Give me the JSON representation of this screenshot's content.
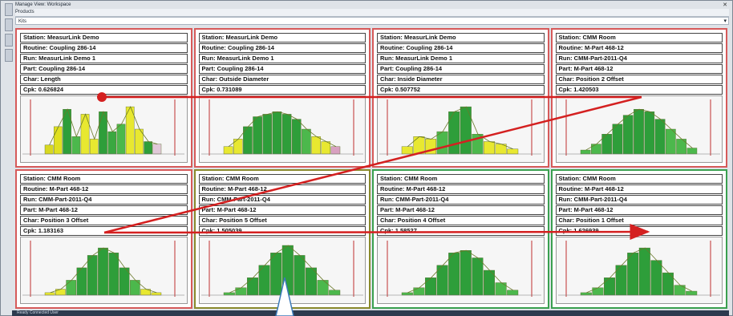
{
  "window": {
    "title": "Manage View: Workspace",
    "subtitle": "Products",
    "filter": "Kits"
  },
  "panels": [
    {
      "station": "Station: MeasurLink Demo",
      "routine": "Routine: Coupling 286-14",
      "run": "Run: MeasurLink Demo 1",
      "part": "Part: Coupling 286-14",
      "char": "Char: Length",
      "cpk": "Cpk: 0.626824",
      "status": "red",
      "bars": [
        {
          "v": 0.18,
          "c": "#d8d820"
        },
        {
          "v": 0.55,
          "c": "#e0e020"
        },
        {
          "v": 0.9,
          "c": "#2e9e3a"
        },
        {
          "v": 0.35,
          "c": "#4cb84c"
        },
        {
          "v": 0.8,
          "c": "#e8e830"
        },
        {
          "v": 0.3,
          "c": "#e8e830"
        },
        {
          "v": 0.85,
          "c": "#2e9e3a"
        },
        {
          "v": 0.45,
          "c": "#3aa840"
        },
        {
          "v": 0.6,
          "c": "#4cb84c"
        },
        {
          "v": 0.95,
          "c": "#e8e830"
        },
        {
          "v": 0.5,
          "c": "#e8e830"
        },
        {
          "v": 0.25,
          "c": "#2e9e3a"
        },
        {
          "v": 0.2,
          "c": "#e0c8d8"
        }
      ]
    },
    {
      "station": "Station: MeasurLink Demo",
      "routine": "Routine: Coupling 286-14",
      "run": "Run: MeasurLink Demo 1",
      "part": "Part: Coupling 286-14",
      "char": "Char: Outside Diameter",
      "cpk": "Cpk: 0.731089",
      "status": "red",
      "bars": [
        {
          "v": 0.15,
          "c": "#e8e830"
        },
        {
          "v": 0.3,
          "c": "#e8e830"
        },
        {
          "v": 0.55,
          "c": "#2e9e3a"
        },
        {
          "v": 0.75,
          "c": "#2e9e3a"
        },
        {
          "v": 0.8,
          "c": "#2e9e3a"
        },
        {
          "v": 0.85,
          "c": "#2e9e3a"
        },
        {
          "v": 0.8,
          "c": "#2e9e3a"
        },
        {
          "v": 0.7,
          "c": "#2e9e3a"
        },
        {
          "v": 0.5,
          "c": "#4cb84c"
        },
        {
          "v": 0.35,
          "c": "#e8e830"
        },
        {
          "v": 0.25,
          "c": "#e8e830"
        },
        {
          "v": 0.15,
          "c": "#d8a0c0"
        }
      ]
    },
    {
      "station": "Station: MeasurLink Demo",
      "routine": "Routine: Coupling 286-14",
      "run": "Run: MeasurLink Demo 1",
      "part": "Part: Coupling 286-14",
      "char": "Char: Inside Diameter",
      "cpk": "Cpk: 0.507752",
      "status": "red",
      "bars": [
        {
          "v": 0.15,
          "c": "#e8e830"
        },
        {
          "v": 0.35,
          "c": "#e8e830"
        },
        {
          "v": 0.3,
          "c": "#e8e830"
        },
        {
          "v": 0.45,
          "c": "#4cb84c"
        },
        {
          "v": 0.85,
          "c": "#2e9e3a"
        },
        {
          "v": 0.95,
          "c": "#2e9e3a"
        },
        {
          "v": 0.4,
          "c": "#4cb84c"
        },
        {
          "v": 0.25,
          "c": "#e8e830"
        },
        {
          "v": 0.2,
          "c": "#e8e830"
        },
        {
          "v": 0.1,
          "c": "#e8e830"
        }
      ]
    },
    {
      "station": "Station: CMM Room",
      "routine": "Routine: M-Part 468-12",
      "run": "Run: CMM-Part-2011-Q4",
      "part": "Part: M-Part 468-12",
      "char": "Char: Position 2 Offset",
      "cpk": "Cpk: 1.420503",
      "status": "red",
      "bars": [
        {
          "v": 0.08,
          "c": "#4cb84c"
        },
        {
          "v": 0.2,
          "c": "#4cb84c"
        },
        {
          "v": 0.4,
          "c": "#2e9e3a"
        },
        {
          "v": 0.6,
          "c": "#2e9e3a"
        },
        {
          "v": 0.78,
          "c": "#2e9e3a"
        },
        {
          "v": 0.9,
          "c": "#2e9e3a"
        },
        {
          "v": 0.85,
          "c": "#2e9e3a"
        },
        {
          "v": 0.7,
          "c": "#2e9e3a"
        },
        {
          "v": 0.5,
          "c": "#4cb84c"
        },
        {
          "v": 0.3,
          "c": "#4cb84c"
        },
        {
          "v": 0.12,
          "c": "#4cb84c"
        }
      ]
    },
    {
      "station": "Station: CMM Room",
      "routine": "Routine: M-Part 468-12",
      "run": "Run: CMM-Part-2011-Q4",
      "part": "Part: M-Part 468-12",
      "char": "Char: Position 3 Offset",
      "cpk": "Cpk: 1.183163",
      "status": "red",
      "bars": [
        {
          "v": 0.05,
          "c": "#e8e830"
        },
        {
          "v": 0.12,
          "c": "#e8e830"
        },
        {
          "v": 0.3,
          "c": "#4cb84c"
        },
        {
          "v": 0.55,
          "c": "#2e9e3a"
        },
        {
          "v": 0.8,
          "c": "#2e9e3a"
        },
        {
          "v": 0.95,
          "c": "#2e9e3a"
        },
        {
          "v": 0.85,
          "c": "#2e9e3a"
        },
        {
          "v": 0.55,
          "c": "#2e9e3a"
        },
        {
          "v": 0.3,
          "c": "#4cb84c"
        },
        {
          "v": 0.12,
          "c": "#e8e830"
        },
        {
          "v": 0.05,
          "c": "#e8e830"
        }
      ]
    },
    {
      "station": "Station: CMM Room",
      "routine": "Routine: M-Part 468-12",
      "run": "Run: CMM-Part-2011-Q4",
      "part": "Part: M-Part 468-12",
      "char": "Char: Position 5 Offset",
      "cpk": "Cpk: 1.505039",
      "status": "olive",
      "bars": [
        {
          "v": 0.05,
          "c": "#4cb84c"
        },
        {
          "v": 0.15,
          "c": "#4cb84c"
        },
        {
          "v": 0.35,
          "c": "#2e9e3a"
        },
        {
          "v": 0.6,
          "c": "#2e9e3a"
        },
        {
          "v": 0.85,
          "c": "#2e9e3a"
        },
        {
          "v": 1.0,
          "c": "#2e9e3a"
        },
        {
          "v": 0.8,
          "c": "#2e9e3a"
        },
        {
          "v": 0.55,
          "c": "#2e9e3a"
        },
        {
          "v": 0.3,
          "c": "#4cb84c"
        },
        {
          "v": 0.1,
          "c": "#4cb84c"
        }
      ]
    },
    {
      "station": "Station: CMM Room",
      "routine": "Routine: M-Part 468-12",
      "run": "Run: CMM-Part-2011-Q4",
      "part": "Part: M-Part 468-12",
      "char": "Char: Position 4 Offset",
      "cpk": "Cpk: 1.58527",
      "status": "green",
      "bars": [
        {
          "v": 0.05,
          "c": "#4cb84c"
        },
        {
          "v": 0.15,
          "c": "#4cb84c"
        },
        {
          "v": 0.35,
          "c": "#2e9e3a"
        },
        {
          "v": 0.6,
          "c": "#2e9e3a"
        },
        {
          "v": 0.85,
          "c": "#2e9e3a"
        },
        {
          "v": 0.9,
          "c": "#2e9e3a"
        },
        {
          "v": 0.75,
          "c": "#2e9e3a"
        },
        {
          "v": 0.5,
          "c": "#2e9e3a"
        },
        {
          "v": 0.25,
          "c": "#4cb84c"
        },
        {
          "v": 0.1,
          "c": "#4cb84c"
        }
      ]
    },
    {
      "station": "Station: CMM Room",
      "routine": "Routine: M-Part 468-12",
      "run": "Run: CMM-Part-2011-Q4",
      "part": "Part: M-Part 468-12",
      "char": "Char: Position 1 Offset",
      "cpk": "Cpk: 1.626939",
      "status": "green",
      "bars": [
        {
          "v": 0.05,
          "c": "#4cb84c"
        },
        {
          "v": 0.15,
          "c": "#4cb84c"
        },
        {
          "v": 0.35,
          "c": "#2e9e3a"
        },
        {
          "v": 0.6,
          "c": "#2e9e3a"
        },
        {
          "v": 0.85,
          "c": "#2e9e3a"
        },
        {
          "v": 0.95,
          "c": "#2e9e3a"
        },
        {
          "v": 0.7,
          "c": "#2e9e3a"
        },
        {
          "v": 0.45,
          "c": "#2e9e3a"
        },
        {
          "v": 0.2,
          "c": "#4cb84c"
        },
        {
          "v": 0.08,
          "c": "#4cb84c"
        }
      ]
    }
  ],
  "statusbar": "Ready   Connected   User"
}
